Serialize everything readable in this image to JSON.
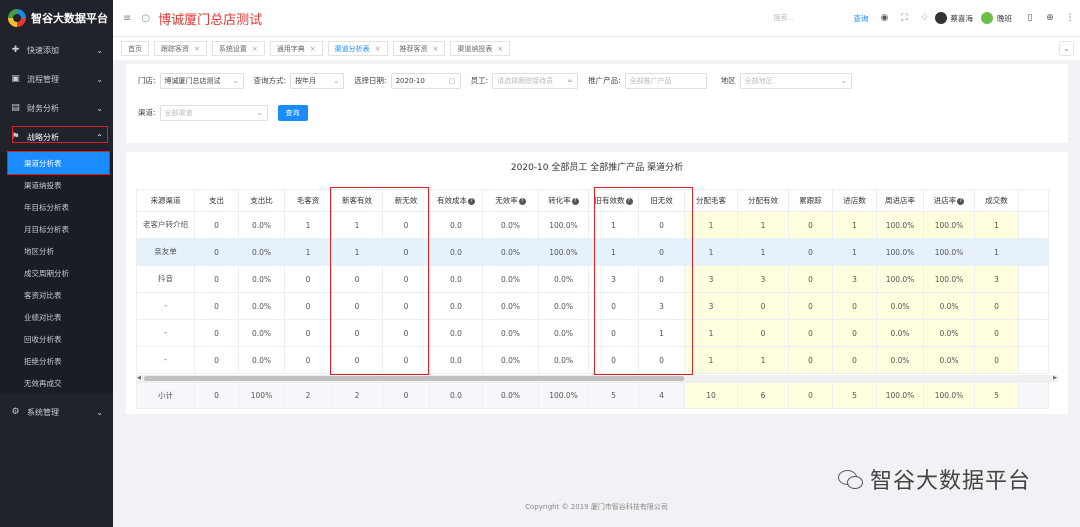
{
  "app": {
    "logo": "智谷大数据平台",
    "title": "博诚厦门总店测试"
  },
  "sidebar": {
    "items": [
      {
        "label": "快速添加",
        "icon": "plus-circle-icon"
      },
      {
        "label": "流程管理",
        "icon": "folder-icon"
      },
      {
        "label": "财务分析",
        "icon": "chart-icon"
      },
      {
        "label": "战略分析",
        "icon": "flag-icon"
      }
    ],
    "sub_items": [
      "渠道分析表",
      "渠道纳投表",
      "年目标分析表",
      "月目标分析表",
      "地区分析",
      "成交周期分析",
      "客资对比表",
      "业绩对比表",
      "回收分析表",
      "拒绝分析表",
      "无效再成交"
    ],
    "last_item": {
      "label": "系统管理",
      "icon": "gear-icon"
    }
  },
  "topbar": {
    "search_placeholder": "搜索...",
    "query_label": "查询",
    "user1": "蔡喜海",
    "user2": "晚班"
  },
  "tabs": [
    "首页",
    "跟踪客资",
    "系统设置",
    "通用字典",
    "渠道分析表",
    "推荐客资",
    "渠道纳投表"
  ],
  "active_tab": 4,
  "filters": {
    "store_label": "门店:",
    "store_value": "博诚厦门总店测试",
    "mode_label": "查询方式:",
    "mode_value": "按年月",
    "date_label": "选择日期:",
    "date_value": "2020-10",
    "staff_label": "员工:",
    "staff_placeholder": "请选择跟踪接待员",
    "product_label": "推广产品:",
    "product_placeholder": "全部推广产品",
    "region_label": "地区",
    "region_placeholder": "全部地区",
    "channel_label": "渠道:",
    "channel_placeholder": "全部渠道",
    "query_button": "查询"
  },
  "report": {
    "title": "2020-10 全部员工 全部推广产品 渠道分析",
    "columns": [
      "来源渠道",
      "支出",
      "支出比",
      "毛客资",
      "新客有效",
      "新无效",
      "有效成本",
      "无效率",
      "转化率",
      "旧有效数",
      "旧无效",
      "分配毛客",
      "分配有效",
      "累跟踪",
      "进店数",
      "周进店率",
      "进店率",
      "成交数"
    ],
    "rows": [
      [
        "老客户转介绍",
        "0",
        "0.0%",
        "1",
        "1",
        "0",
        "0.0",
        "0.0%",
        "100.0%",
        "1",
        "0",
        "1",
        "1",
        "0",
        "1",
        "100.0%",
        "100.0%",
        "1"
      ],
      [
        "亲友单",
        "0",
        "0.0%",
        "1",
        "1",
        "0",
        "0.0",
        "0.0%",
        "100.0%",
        "1",
        "0",
        "1",
        "1",
        "0",
        "1",
        "100.0%",
        "100.0%",
        "1"
      ],
      [
        "抖音",
        "0",
        "0.0%",
        "0",
        "0",
        "0",
        "0.0",
        "0.0%",
        "0.0%",
        "3",
        "0",
        "3",
        "3",
        "0",
        "3",
        "100.0%",
        "100.0%",
        "3"
      ],
      [
        "-",
        "0",
        "0.0%",
        "0",
        "0",
        "0",
        "0.0",
        "0.0%",
        "0.0%",
        "0",
        "3",
        "3",
        "0",
        "0",
        "0",
        "0.0%",
        "0.0%",
        "0"
      ],
      [
        "-",
        "0",
        "0.0%",
        "0",
        "0",
        "0",
        "0.0",
        "0.0%",
        "0.0%",
        "0",
        "1",
        "1",
        "0",
        "0",
        "0",
        "0.0%",
        "0.0%",
        "0"
      ],
      [
        "-",
        "0",
        "0.0%",
        "0",
        "0",
        "0",
        "0.0",
        "0.0%",
        "0.0%",
        "0",
        "0",
        "1",
        "1",
        "0",
        "0",
        "0.0%",
        "0.0%",
        "0"
      ]
    ],
    "summary": [
      "小计",
      "0",
      "100%",
      "2",
      "2",
      "0",
      "0.0",
      "0.0%",
      "100.0%",
      "5",
      "4",
      "10",
      "6",
      "0",
      "5",
      "100.0%",
      "100.0%",
      "5"
    ]
  },
  "footer": "Copyright © 2019 厦门市智谷科技有限公司",
  "watermark": "智谷大数据平台"
}
